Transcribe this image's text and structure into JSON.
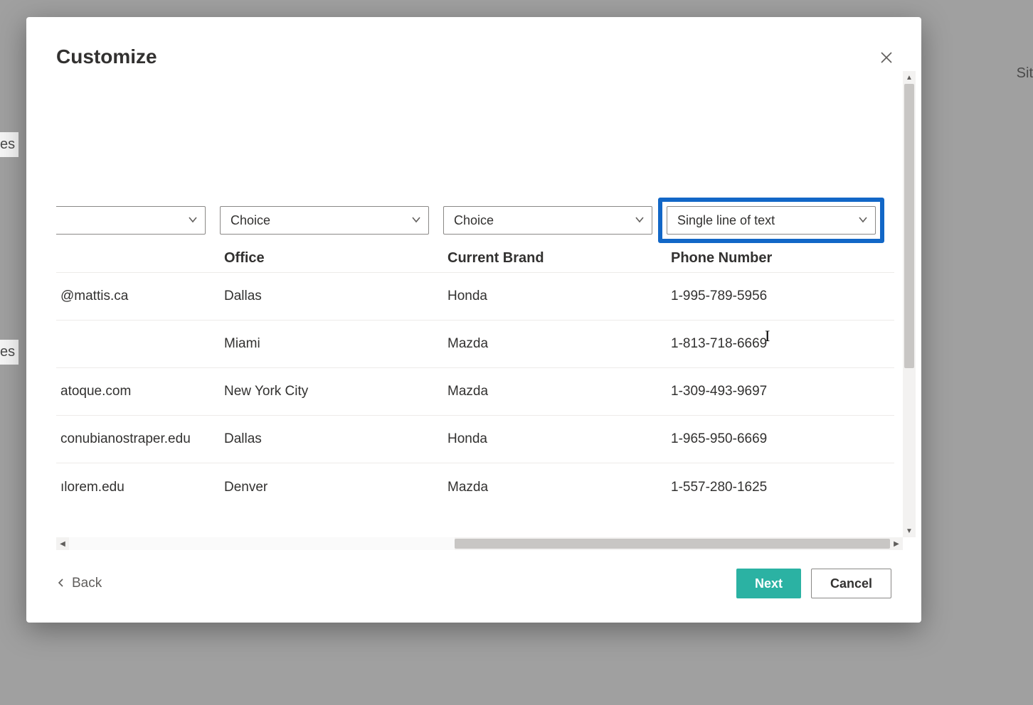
{
  "background": {
    "left_hint_1": "es",
    "left_hint_2": "es",
    "right_hint": "Sit"
  },
  "modal": {
    "title": "Customize",
    "back_label": "Back",
    "next_label": "Next",
    "cancel_label": "Cancel"
  },
  "dropdowns": {
    "col0": "",
    "col1": "Choice",
    "col2": "Choice",
    "col3": "Single line of text"
  },
  "headers": {
    "col0": "",
    "col1": "Office",
    "col2": "Current Brand",
    "col3": "Phone Number"
  },
  "rows": [
    {
      "c0": "@mattis.ca",
      "c1": "Dallas",
      "c2": "Honda",
      "c3": "1-995-789-5956"
    },
    {
      "c0": "",
      "c1": "Miami",
      "c2": "Mazda",
      "c3": "1-813-718-6669"
    },
    {
      "c0": "atoque.com",
      "c1": "New York City",
      "c2": "Mazda",
      "c3": "1-309-493-9697"
    },
    {
      "c0": "conubianostraper.edu",
      "c1": "Dallas",
      "c2": "Honda",
      "c3": "1-965-950-6669"
    },
    {
      "c0": "ılorem.edu",
      "c1": "Denver",
      "c2": "Mazda",
      "c3": "1-557-280-1625"
    }
  ]
}
